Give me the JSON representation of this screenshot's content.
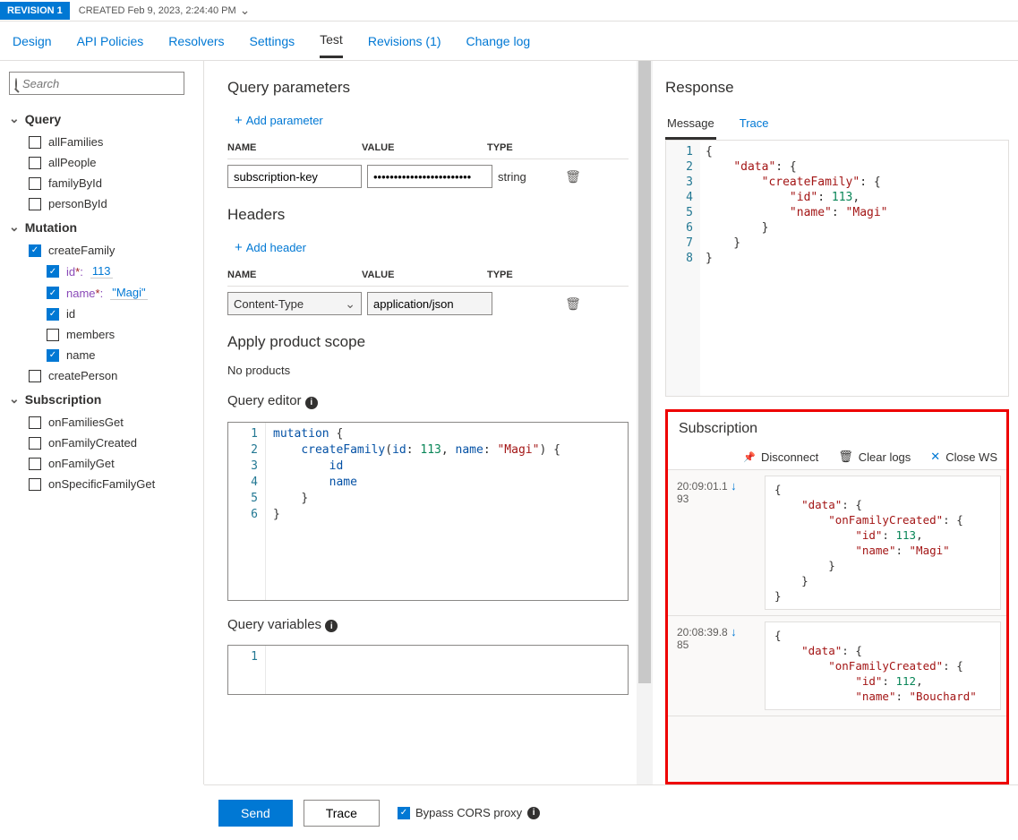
{
  "revision": {
    "badge": "REVISION 1",
    "created": "CREATED Feb 9, 2023, 2:24:40 PM"
  },
  "tabs": [
    "Design",
    "API Policies",
    "Resolvers",
    "Settings",
    "Test",
    "Revisions (1)",
    "Change log"
  ],
  "activeTab": "Test",
  "search": {
    "placeholder": "Search"
  },
  "tree": {
    "query": {
      "title": "Query",
      "items": [
        "allFamilies",
        "allPeople",
        "familyById",
        "personById"
      ]
    },
    "mutation": {
      "title": "Mutation",
      "createFamily": {
        "label": "createFamily",
        "params": [
          {
            "name": "id",
            "req": true,
            "value": "113"
          },
          {
            "name": "name",
            "req": true,
            "value": "\"Magi\""
          }
        ],
        "fields": [
          {
            "name": "id",
            "checked": true
          },
          {
            "name": "members",
            "checked": false
          },
          {
            "name": "name",
            "checked": true
          }
        ]
      },
      "createPerson": {
        "label": "createPerson"
      }
    },
    "subscription": {
      "title": "Subscription",
      "items": [
        "onFamiliesGet",
        "onFamilyCreated",
        "onFamilyGet",
        "onSpecificFamilyGet"
      ]
    }
  },
  "center": {
    "qp": {
      "title": "Query parameters",
      "add": "Add parameter",
      "cols": [
        "NAME",
        "VALUE",
        "TYPE"
      ],
      "rows": [
        {
          "name": "subscription-key",
          "value": "••••••••••••••••••••••••",
          "type": "string"
        }
      ]
    },
    "hdrs": {
      "title": "Headers",
      "add": "Add header",
      "cols": [
        "NAME",
        "VALUE",
        "TYPE"
      ],
      "rows": [
        {
          "name": "Content-Type",
          "value": "application/json",
          "type": ""
        }
      ]
    },
    "scope": {
      "title": "Apply product scope",
      "text": "No products"
    },
    "editor": {
      "title": "Query editor",
      "lines": [
        "mutation {",
        "    createFamily(id: 113, name: \"Magi\") {",
        "        id",
        "        name",
        "    }",
        "}"
      ]
    },
    "vars": {
      "title": "Query variables"
    }
  },
  "response": {
    "title": "Response",
    "tabs": [
      "Message",
      "Trace"
    ],
    "active": "Message",
    "json": {
      "data": {
        "createFamily": {
          "id": 113,
          "name": "Magi"
        }
      }
    }
  },
  "subscription": {
    "title": "Subscription",
    "toolbar": {
      "disconnect": "Disconnect",
      "clear": "Clear logs",
      "close": "Close WS"
    },
    "logs": [
      {
        "ts": "20:09:01.193",
        "payload": {
          "data": {
            "onFamilyCreated": {
              "id": 113,
              "name": "Magi"
            }
          }
        }
      },
      {
        "ts": "20:08:39.885",
        "payload": {
          "data": {
            "onFamilyCreated": {
              "id": 112,
              "name": "Bouchard"
            }
          }
        },
        "truncated": true
      }
    ]
  },
  "bottom": {
    "send": "Send",
    "trace": "Trace",
    "bypass": "Bypass CORS proxy"
  }
}
